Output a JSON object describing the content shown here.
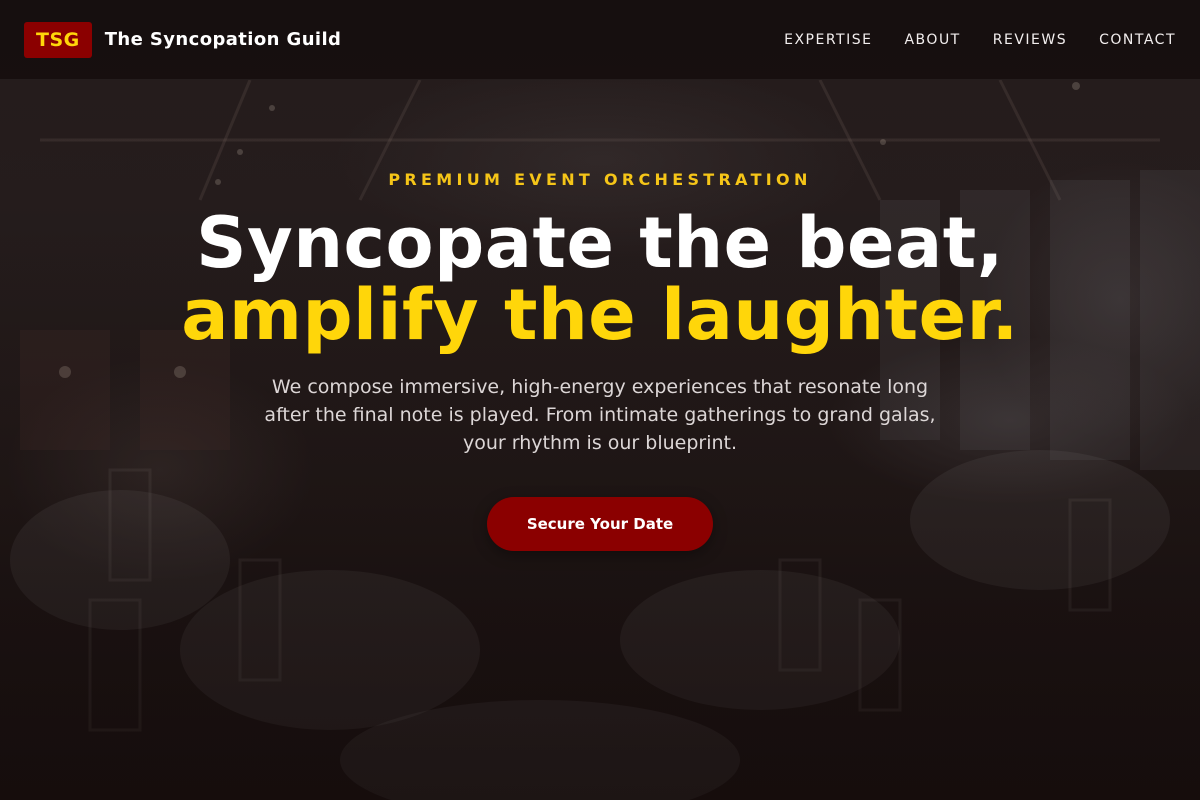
{
  "header": {
    "logo_text": "TSG",
    "brand_name": "The Syncopation Guild",
    "nav": [
      {
        "label": "EXPERTISE"
      },
      {
        "label": "ABOUT"
      },
      {
        "label": "REVIEWS"
      },
      {
        "label": "CONTACT"
      }
    ]
  },
  "hero": {
    "eyebrow": "PREMIUM EVENT ORCHESTRATION",
    "headline_line1": "Syncopate the beat,",
    "headline_accent": "amplify the laughter.",
    "subtext": "We compose immersive, high-energy experiences that resonate long after the final note is played. From intimate gatherings to grand galas, your rhythm is our blueprint.",
    "cta_label": "Secure Your Date",
    "background": "banquet-hall-photo"
  },
  "colors": {
    "brand_red": "#8b0000",
    "accent_yellow": "#ffd60a",
    "header_bg": "#160e0e"
  }
}
